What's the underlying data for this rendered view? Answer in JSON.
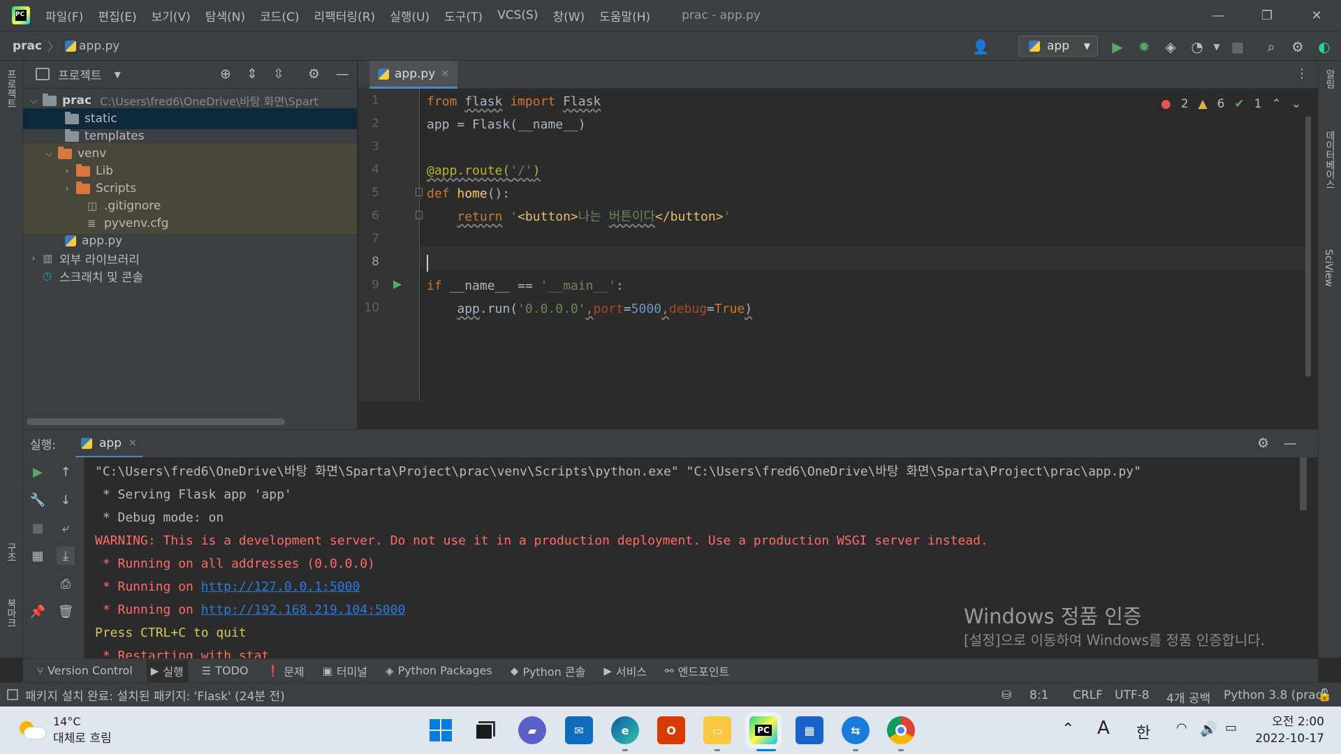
{
  "menu": [
    "파일(F)",
    "편집(E)",
    "보기(V)",
    "탐색(N)",
    "코드(C)",
    "리팩터링(R)",
    "실행(U)",
    "도구(T)",
    "VCS(S)",
    "창(W)",
    "도움말(H)"
  ],
  "window_title": "prac - app.py",
  "breadcrumb": {
    "project": "prac",
    "file": "app.py"
  },
  "run_config": {
    "name": "app"
  },
  "project_panel": {
    "title": "프로젝트",
    "tree": [
      {
        "label": "prac",
        "path": "C:\\Users\\fred6\\OneDrive\\바탕 화면\\Spart",
        "kind": "root"
      },
      {
        "label": "static",
        "kind": "folder",
        "selected": true
      },
      {
        "label": "templates",
        "kind": "folder"
      },
      {
        "label": "venv",
        "kind": "folder-excluded"
      },
      {
        "label": "Lib",
        "kind": "folder-excluded"
      },
      {
        "label": "Scripts",
        "kind": "folder-excluded"
      },
      {
        "label": ".gitignore",
        "kind": "file"
      },
      {
        "label": "pyvenv.cfg",
        "kind": "file"
      },
      {
        "label": "app.py",
        "kind": "python"
      },
      {
        "label": "외부 라이브러리",
        "kind": "library"
      },
      {
        "label": "스크래치 및 콘솔",
        "kind": "scratch"
      }
    ]
  },
  "editor": {
    "tab": "app.py",
    "inspections": {
      "errors": "2",
      "warnings": "6",
      "ok": "1"
    },
    "line_numbers": [
      "1",
      "2",
      "3",
      "4",
      "5",
      "6",
      "7",
      "8",
      "9",
      "10"
    ],
    "code": [
      "from flask import Flask",
      "app = Flask(__name__)",
      "",
      "@app.route('/')",
      "def home():",
      "    return '<button>나는 버튼이다</button>'",
      "",
      "",
      "if __name__ == '__main__':",
      "    app.run('0.0.0.0',port=5000,debug=True)"
    ]
  },
  "run_panel": {
    "label": "실행:",
    "tab": "app",
    "console": [
      {
        "text": "\"C:\\Users\\fred6\\OneDrive\\바탕 화면\\Sparta\\Project\\prac\\venv\\Scripts\\python.exe\" \"C:\\Users\\fred6\\OneDrive\\바탕 화면\\Sparta\\Project\\prac\\app.py\"",
        "style": "normal"
      },
      {
        "text": " * Serving Flask app 'app'",
        "style": "normal"
      },
      {
        "text": " * Debug mode: on",
        "style": "normal"
      },
      {
        "text": "WARNING: This is a development server. Do not use it in a production deployment. Use a production WSGI server instead.",
        "style": "warn"
      },
      {
        "text": " * Running on all addresses (0.0.0.0)",
        "style": "red"
      },
      {
        "prefix": " * Running on ",
        "link": "http://127.0.0.1:5000",
        "style": "red-link"
      },
      {
        "prefix": " * Running on ",
        "link": "http://192.168.219.104:5000",
        "style": "red-link"
      },
      {
        "text": "Press CTRL+C to quit",
        "style": "yellow"
      },
      {
        "text": " * Restarting with stat",
        "style": "red"
      }
    ]
  },
  "windows_activation": {
    "title": "Windows 정품 인증",
    "subtitle": "[설정]으로 이동하여 Windows를 정품 인증합니다."
  },
  "tool_windows": [
    "Version Control",
    "실행",
    "TODO",
    "문제",
    "터미널",
    "Python Packages",
    "Python 콘솔",
    "서비스",
    "엔드포인트"
  ],
  "status": {
    "message": "패키지 설치 완료: 설치된 패키지: 'Flask' (24분 전)",
    "position": "8:1",
    "line_sep": "CRLF",
    "encoding": "UTF-8",
    "indent": "4개 공백",
    "interpreter": "Python 3.8 (prac)"
  },
  "left_strip_labels": {
    "project": "프로젝트",
    "structure": "구조",
    "bookmarks": "북마크"
  },
  "right_strip_labels": {
    "notifications": "알림",
    "database": "데이터베이스",
    "sciview": "SciView"
  },
  "taskbar": {
    "weather": {
      "temp": "14°C",
      "desc": "대체로 흐림"
    },
    "ime": "A",
    "lang": "한",
    "time": "오전 2:00",
    "date": "2022-10-17"
  }
}
